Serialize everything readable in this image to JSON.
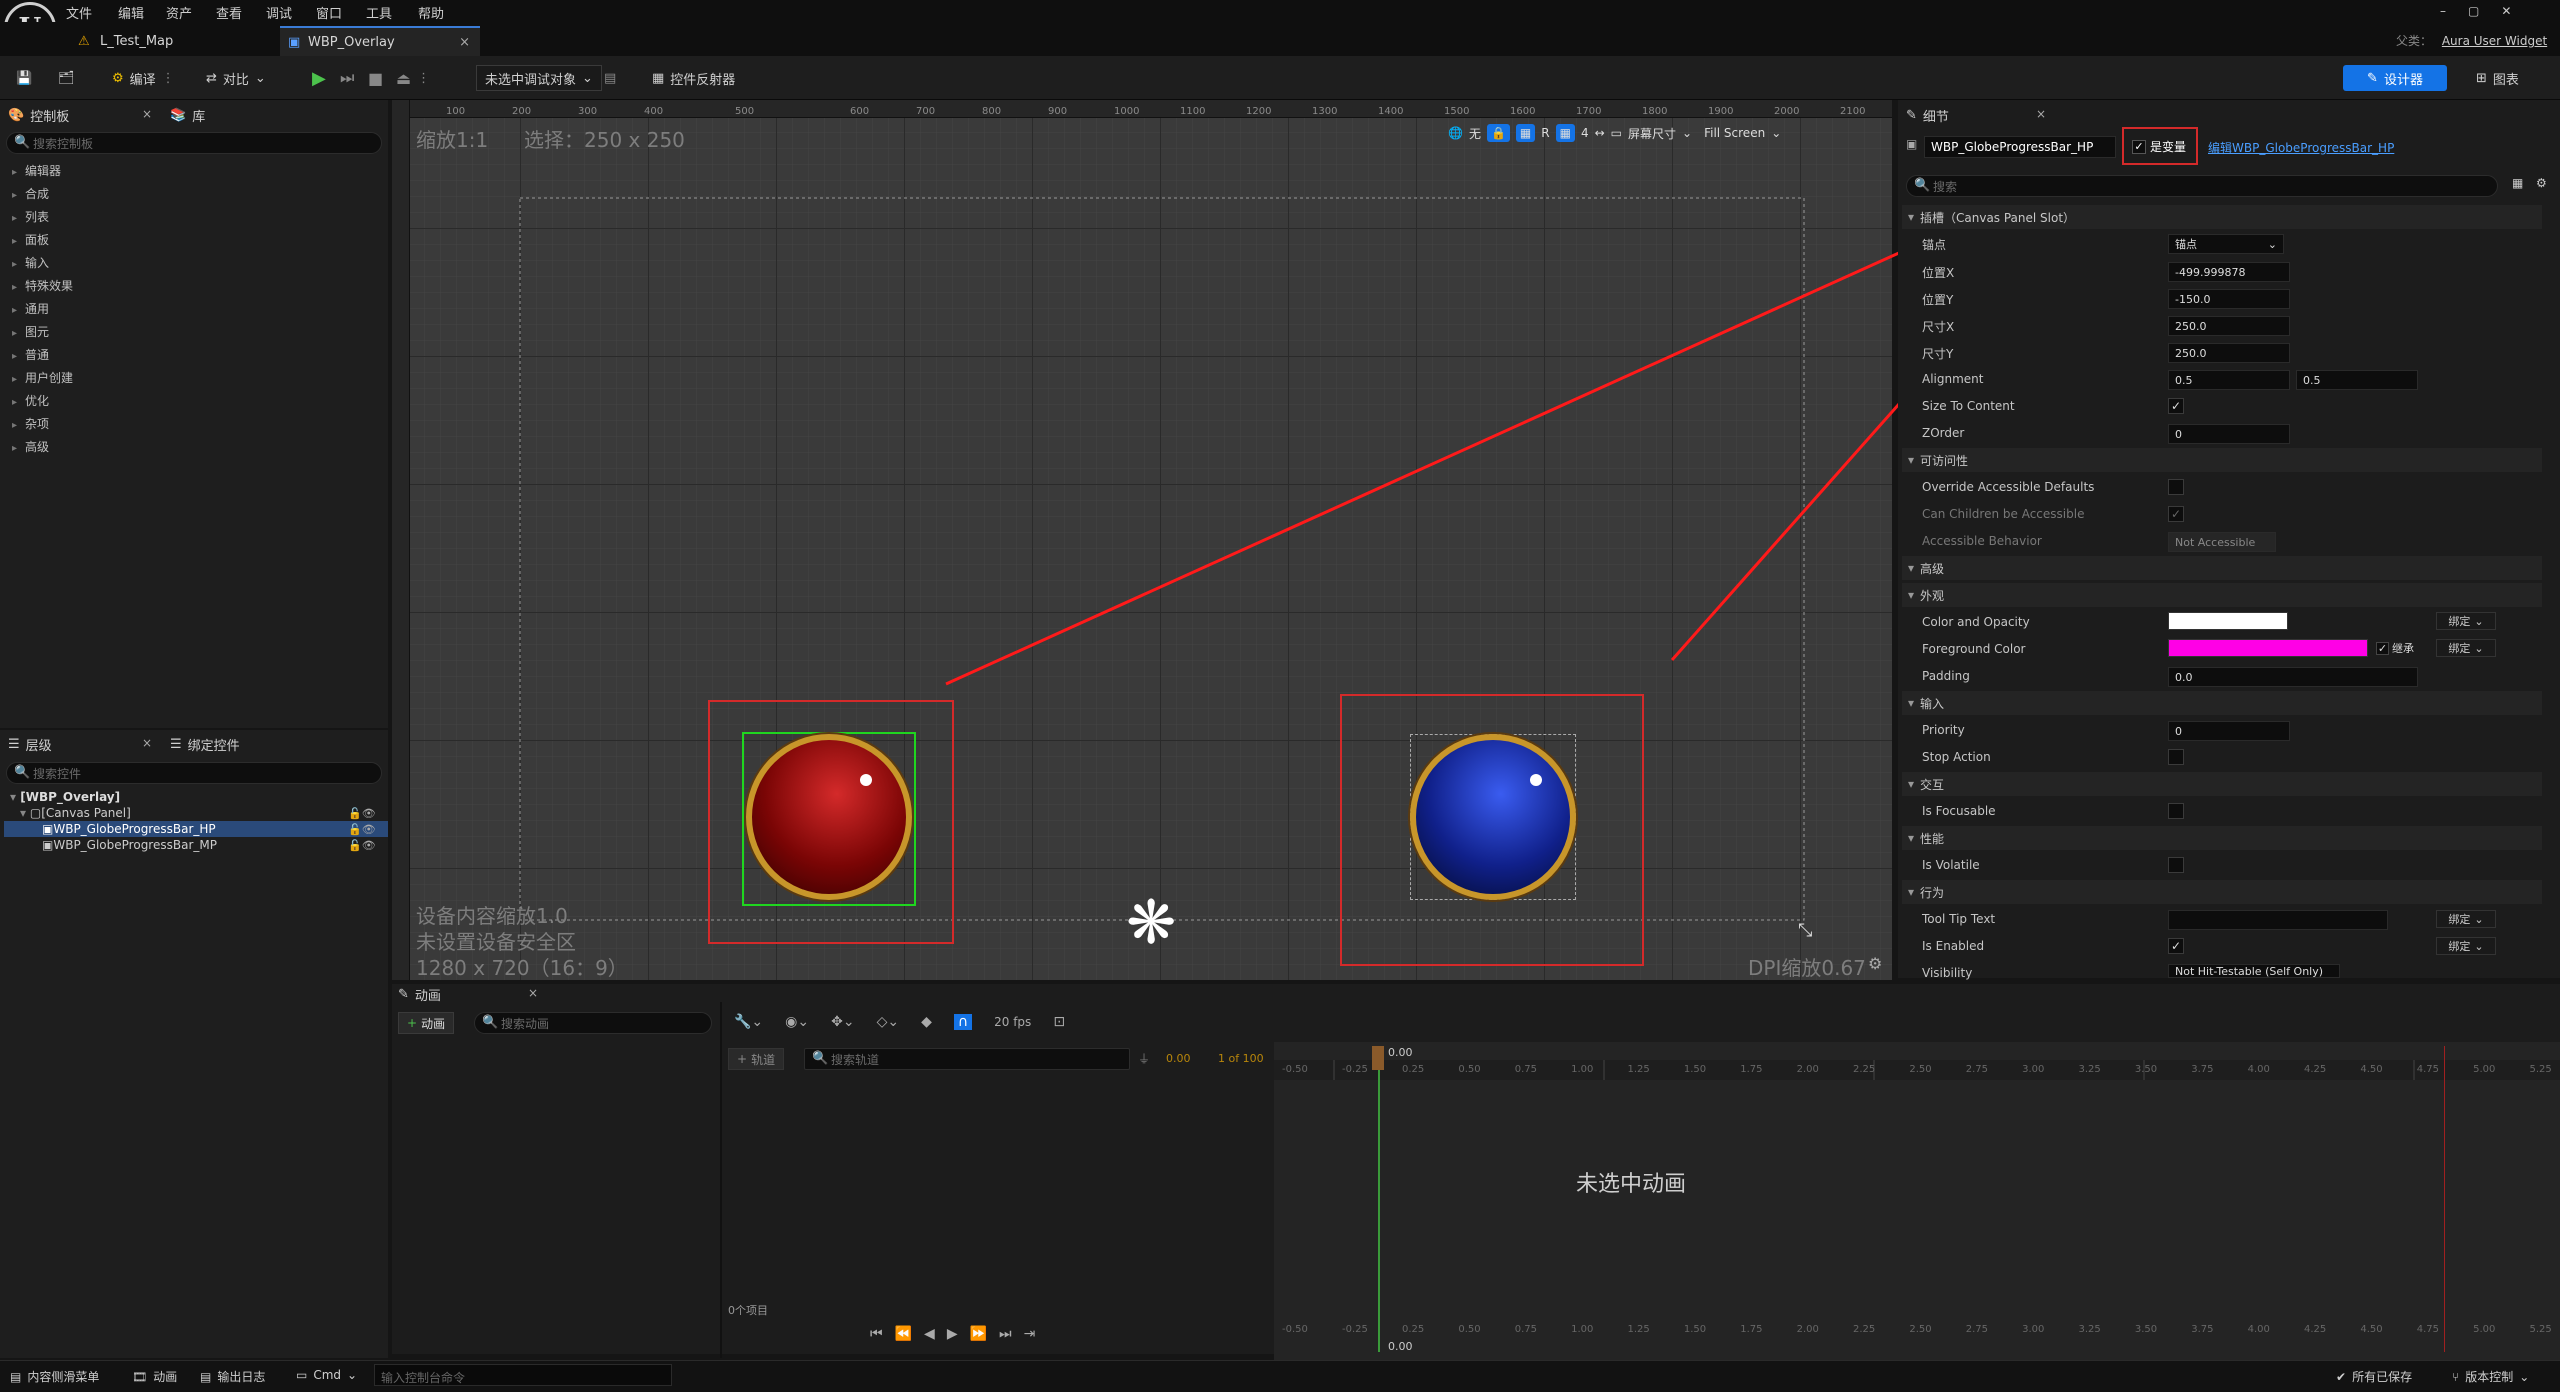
{
  "menubar": {
    "items": [
      "文件",
      "编辑",
      "资产",
      "查看",
      "调试",
      "窗口",
      "工具",
      "帮助"
    ],
    "logo": "U"
  },
  "tabs": [
    {
      "label": "L_Test_Map",
      "icon": "level-icon"
    },
    {
      "label": "WBP_Overlay",
      "icon": "widget-icon",
      "close": "×"
    }
  ],
  "window": {
    "parent_label": "父类：",
    "parent_value": "Aura User Widget",
    "controls": [
      "–",
      "▢",
      "✕"
    ]
  },
  "toolbar": {
    "compile": "编译",
    "diff": "对比",
    "debug_target": "未选中调试对象",
    "widget_reflector": "控件反射器",
    "design_btn": "设计器",
    "graph_btn": "图表"
  },
  "palette": {
    "tab1": "控制板",
    "tab2": "库",
    "search_placeholder": "搜索控制板",
    "items": [
      "编辑器",
      "合成",
      "列表",
      "面板",
      "输入",
      "特殊效果",
      "通用",
      "图元",
      "普通",
      "用户创建",
      "优化",
      "杂项",
      "高级"
    ]
  },
  "hierarchy": {
    "tab1": "层级",
    "tab2": "绑定控件",
    "search_placeholder": "搜索控件",
    "root": "[WBP_Overlay]",
    "canvas": "[Canvas Panel]",
    "children": [
      "WBP_GlobeProgressBar_HP",
      "WBP_GlobeProgressBar_MP"
    ]
  },
  "designer": {
    "zoom": "缩放1:1",
    "selection": "选择：250 x 250",
    "ruler": [
      "100",
      "200",
      "300",
      "400",
      "500",
      "600",
      "700",
      "800",
      "900",
      "1000",
      "1100",
      "1200",
      "1300",
      "1400",
      "1500",
      "1600",
      "1700",
      "1800",
      "1900",
      "2000",
      "2100"
    ],
    "toolbar_items": [
      "无",
      "R",
      "4",
      "屏幕尺寸",
      "Fill Screen"
    ],
    "device_info": [
      "设备内容缩放1.0",
      "未设置设备安全区",
      "1280 x 720（16：9）"
    ],
    "dpi": "DPI缩放0.67",
    "globe_hp_color": "#8b0a0a",
    "globe_mp_color": "#1a2da0"
  },
  "details": {
    "tab": "细节",
    "widget_name": "WBP_GlobeProgressBar_HP",
    "is_variable": "是变量",
    "edit_link": "编辑WBP_GlobeProgressBar_HP",
    "search_placeholder": "搜索",
    "slot_section": "插槽（Canvas Panel Slot）",
    "anchor_label": "锚点",
    "anchor_value": "锚点",
    "pos_x_label": "位置X",
    "pos_x": "-499.999878",
    "pos_y_label": "位置Y",
    "pos_y": "-150.0",
    "size_x_label": "尺寸X",
    "size_x": "250.0",
    "size_y_label": "尺寸Y",
    "size_y": "250.0",
    "alignment_label": "Alignment",
    "alignment_x": "0.5",
    "alignment_y": "0.5",
    "size_to_content": "Size To Content",
    "zorder_label": "ZOrder",
    "zorder": "0",
    "accessibility_section": "可访问性",
    "override_accessible": "Override Accessible Defaults",
    "children_accessible": "Can Children be Accessible",
    "accessible_behavior": "Accessible Behavior",
    "accessible_behavior_value": "Not Accessible",
    "advanced_section": "高级",
    "appearance_section": "外观",
    "color_opacity": "Color and Opacity",
    "foreground_color": "Foreground Color",
    "inherit": "继承",
    "foreground_hex": "#ff00e6",
    "padding": "Padding",
    "padding_value": "0.0",
    "input_section": "输入",
    "priority": "Priority",
    "priority_value": "0",
    "stop_action": "Stop Action",
    "interaction_section": "交互",
    "is_focusable": "Is Focusable",
    "performance_section": "性能",
    "is_volatile": "Is Volatile",
    "behavior_section": "行为",
    "tooltip": "Tool Tip Text",
    "is_enabled": "Is Enabled",
    "visibility": "Visibility",
    "visibility_value": "Not Hit-Testable (Self Only)",
    "bind": "绑定"
  },
  "animation": {
    "tab": "动画",
    "add_btn": "动画",
    "search_placeholder": "搜索动画",
    "track_btn": "轨道",
    "track_search": "搜索轨道",
    "fps": "20 fps",
    "time": "0.00",
    "frame": "1 of 100",
    "items_count": "0个项目",
    "empty_msg": "未选中动画",
    "timeline": [
      "-0.50",
      "-0.25",
      "0.25",
      "0.50",
      "0.75",
      "1.00",
      "1.25",
      "1.50",
      "1.75",
      "2.00",
      "2.25",
      "2.50",
      "2.75",
      "3.00",
      "3.25",
      "3.50",
      "3.75",
      "4.00",
      "4.25",
      "4.50",
      "4.75",
      "5.00",
      "5.25"
    ],
    "playhead": "0.00"
  },
  "statusbar": {
    "content_drawer": "内容侧滑菜单",
    "animation": "动画",
    "output_log": "输出日志",
    "cmd": "Cmd",
    "cmd_placeholder": "输入控制台命令",
    "saved": "所有已保存",
    "source_control": "版本控制"
  }
}
